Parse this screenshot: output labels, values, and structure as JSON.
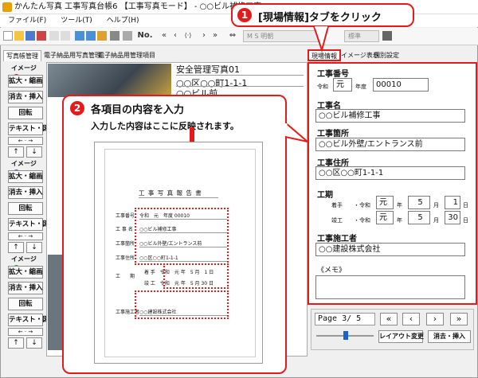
{
  "window": {
    "title": "かんたん写真 工事写真台帳6 【工事写真モード】 - ○○ビル補修工事 *"
  },
  "menu": [
    "ファイル(F)",
    "ツール(T)",
    "ヘルプ(H)"
  ],
  "toolbar": {
    "no_label": "No.",
    "photo_combo": "M S 明朝",
    "size_combo": "標準"
  },
  "tabs_left": [
    "写真帳管理",
    "電子納品用写真管理",
    "電子納品用管理項目"
  ],
  "tabs_right": [
    "現場情報",
    "イメージ表示",
    "個別設定"
  ],
  "groups": [
    {
      "head": "イメージ",
      "num": "1",
      "color": "#e51b1b",
      "b1": "拡大・縮画",
      "b2": "消去・挿入",
      "b3": "回転",
      "b4": "テキスト・図",
      "arr": [
        "←",
        "→",
        "↑",
        "↓"
      ]
    },
    {
      "head": "イメージ",
      "num": "2",
      "color": "#1a64c8",
      "b1": "拡大・縮画",
      "b2": "消去・挿入",
      "b3": "回転",
      "b4": "テキスト・図",
      "arr": [
        "←",
        "→",
        "↑",
        "↓"
      ]
    },
    {
      "head": "イメージ",
      "num": "3",
      "color": "#2a9a2a",
      "b1": "拡大・縮画",
      "b2": "消去・挿入",
      "b3": "回転",
      "b4": "テキスト・図",
      "arr": [
        "←",
        "→",
        "↑",
        "↓"
      ]
    }
  ],
  "sheet": {
    "header": "安全管理写真01",
    "addr1": "○○区○○町1-1-1",
    "addr2": "○○ビル前"
  },
  "form": {
    "kouji_bango_label": "工事番号",
    "reiwa": "令和",
    "year": "元",
    "nendo": "年度",
    "number": "00010",
    "koujimei_label": "工事名",
    "koujimei": "○○ビル補修工事",
    "kasho_label": "工事箇所",
    "kasho": "○○ビル外壁/エントランス前",
    "jusho_label": "工事住所",
    "jusho": "○○区○○町1-1-1",
    "kiki_label": "工期",
    "start_label": "着手",
    "start_era": "・令和",
    "start_year": "元",
    "start_month": "5",
    "start_day": "1",
    "end_label": "竣工",
    "end_era": "・令和",
    "end_year": "元",
    "end_month": "5",
    "end_day": "30",
    "y": "年",
    "m": "月",
    "d": "日",
    "sekou_label": "工事施工者",
    "sekou": "○○建設株式会社",
    "memo_label": "《メモ》"
  },
  "nav": {
    "page": "Page 3/ 5",
    "layout_btn": "レイアウト変更",
    "erase_btn": "消去・挿入"
  },
  "callout1": {
    "num": "1",
    "text": "[現場情報]タブをクリック"
  },
  "callout2": {
    "num": "2",
    "title": "各項目の内容を入力",
    "sub": "入力した内容はここに反映されます。"
  },
  "doc": {
    "title": "工 事 写 真 報 告 書",
    "rows": [
      {
        "k": "工事番号",
        "v": "令和　元　年度 00010"
      },
      {
        "k": "工 事 名",
        "v": "○○ビル補修工事"
      },
      {
        "k": "工事箇所",
        "v": "○○ビル外壁/エントランス前"
      },
      {
        "k": "工事住所",
        "v": "○○区○○町1-1-1"
      }
    ],
    "kiki": "工　　期",
    "kiki_rows": [
      "着 手　令和　元 年　5 月　1 日",
      "竣 工　令和　元 年　5 月 30 日"
    ],
    "sekou_k": "工事施工者",
    "sekou_v": "○○建設株式会社"
  }
}
